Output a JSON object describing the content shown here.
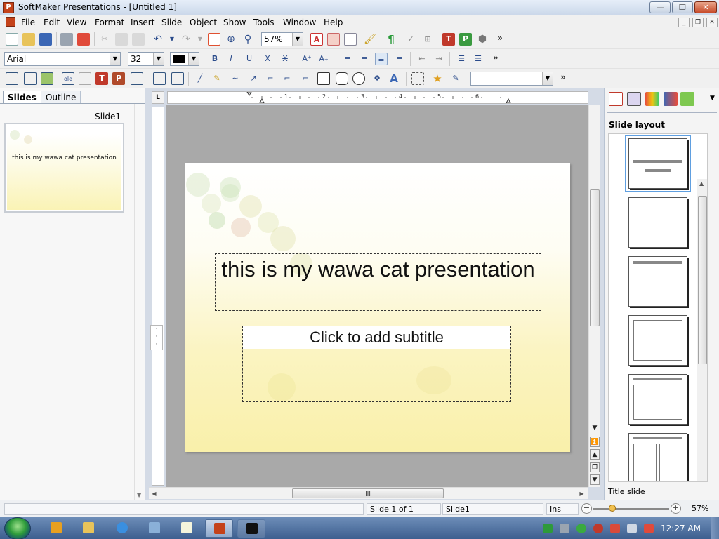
{
  "window": {
    "title": "SoftMaker Presentations - [Untitled 1]",
    "minimize": "—",
    "maximize": "❐",
    "close": "✕"
  },
  "menu": {
    "items": [
      "File",
      "Edit",
      "View",
      "Format",
      "Insert",
      "Slide",
      "Object",
      "Show",
      "Tools",
      "Window",
      "Help"
    ],
    "mdi_minimize": "_",
    "mdi_restore": "❐",
    "mdi_close": "✕"
  },
  "toolbar1": {
    "zoom_value": "57%",
    "overflow": "»"
  },
  "toolbar2": {
    "font_name": "Arial",
    "font_size": "32",
    "overflow": "»"
  },
  "toolbar3": {
    "object_combo_value": "",
    "overflow": "»"
  },
  "left_pane": {
    "tabs": [
      "Slides",
      "Outline"
    ],
    "slide_label": "Slide1",
    "thumbnail_text": "this is my wawa cat presentation"
  },
  "ruler": {
    "corner_label": "L",
    "numbers": [
      "1",
      "2",
      "3",
      "4",
      "5",
      "6"
    ]
  },
  "slide": {
    "title": "this is my wawa cat presentation",
    "subtitle_placeholder": "Click to add subtitle"
  },
  "right_pane": {
    "heading": "Slide layout",
    "caption": "Title slide"
  },
  "status": {
    "slide_position": "Slide 1 of 1",
    "slide_name": "Slide1",
    "mode": "Ins",
    "zoom": "57%"
  },
  "taskbar": {
    "clock": "12:27 AM"
  },
  "colors": {
    "accent": "#5f9fe0",
    "slide_bg_bottom": "#f9f0aa",
    "app_icon": "#c4421a"
  }
}
